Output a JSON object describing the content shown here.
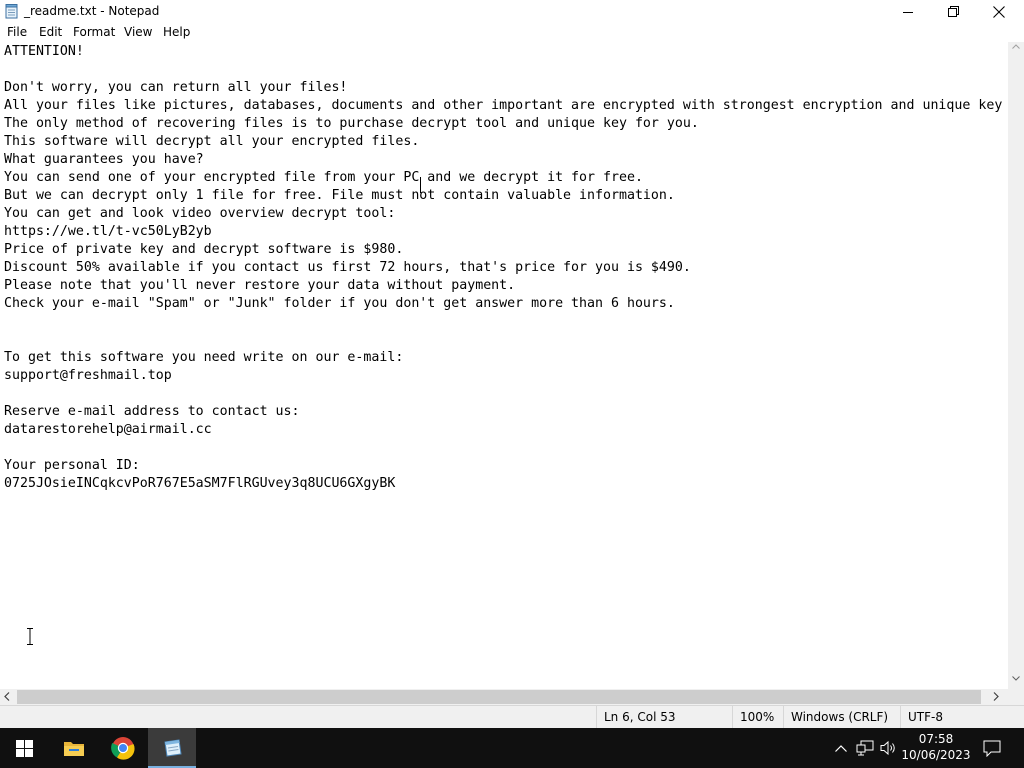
{
  "window": {
    "title": "_readme.txt - Notepad",
    "controls": [
      "minimize",
      "maximize",
      "close"
    ]
  },
  "menu": {
    "items": [
      "File",
      "Edit",
      "Format",
      "View",
      "Help"
    ]
  },
  "editor": {
    "lines": [
      "ATTENTION!",
      "",
      "Don't worry, you can return all your files!",
      "All your files like pictures, databases, documents and other important are encrypted with strongest encryption and unique key",
      "The only method of recovering files is to purchase decrypt tool and unique key for you.",
      "This software will decrypt all your encrypted files.",
      "What guarantees you have?",
      "You can send one of your encrypted file from your PC and we decrypt it for free.",
      "But we can decrypt only 1 file for free. File must not contain valuable information.",
      "You can get and look video overview decrypt tool:",
      "https://we.tl/t-vc50LyB2yb",
      "Price of private key and decrypt software is $980.",
      "Discount 50% available if you contact us first 72 hours, that's price for you is $490.",
      "Please note that you'll never restore your data without payment.",
      "Check your e-mail \"Spam\" or \"Junk\" folder if you don't get answer more than 6 hours.",
      "",
      "",
      "To get this software you need write on our e-mail:",
      "support@freshmail.top",
      "",
      "Reserve e-mail address to contact us:",
      "datarestorehelp@airmail.cc",
      "",
      "Your personal ID:",
      "0725JOsieINCqkcvPoR767E5aSM7FlRGUvey3q8UCU6GXgyBK"
    ]
  },
  "status": {
    "position": "Ln 6, Col 53",
    "zoom": "100%",
    "line_ending": "Windows (CRLF)",
    "encoding": "UTF-8"
  },
  "taskbar": {
    "apps": [
      "start-icon",
      "file-explorer-icon",
      "chrome-icon",
      "notepad-icon"
    ],
    "active_app": "notepad",
    "tray_icons": [
      "chevron-up-icon",
      "network-icon",
      "volume-icon",
      "notifications-icon"
    ],
    "time": "07:58",
    "date": "10/06/2023"
  },
  "colors": {
    "taskbar_bg": "#101010",
    "active_task_underline": "#78b0e0",
    "statusbar_bg": "#f0f0f0"
  }
}
